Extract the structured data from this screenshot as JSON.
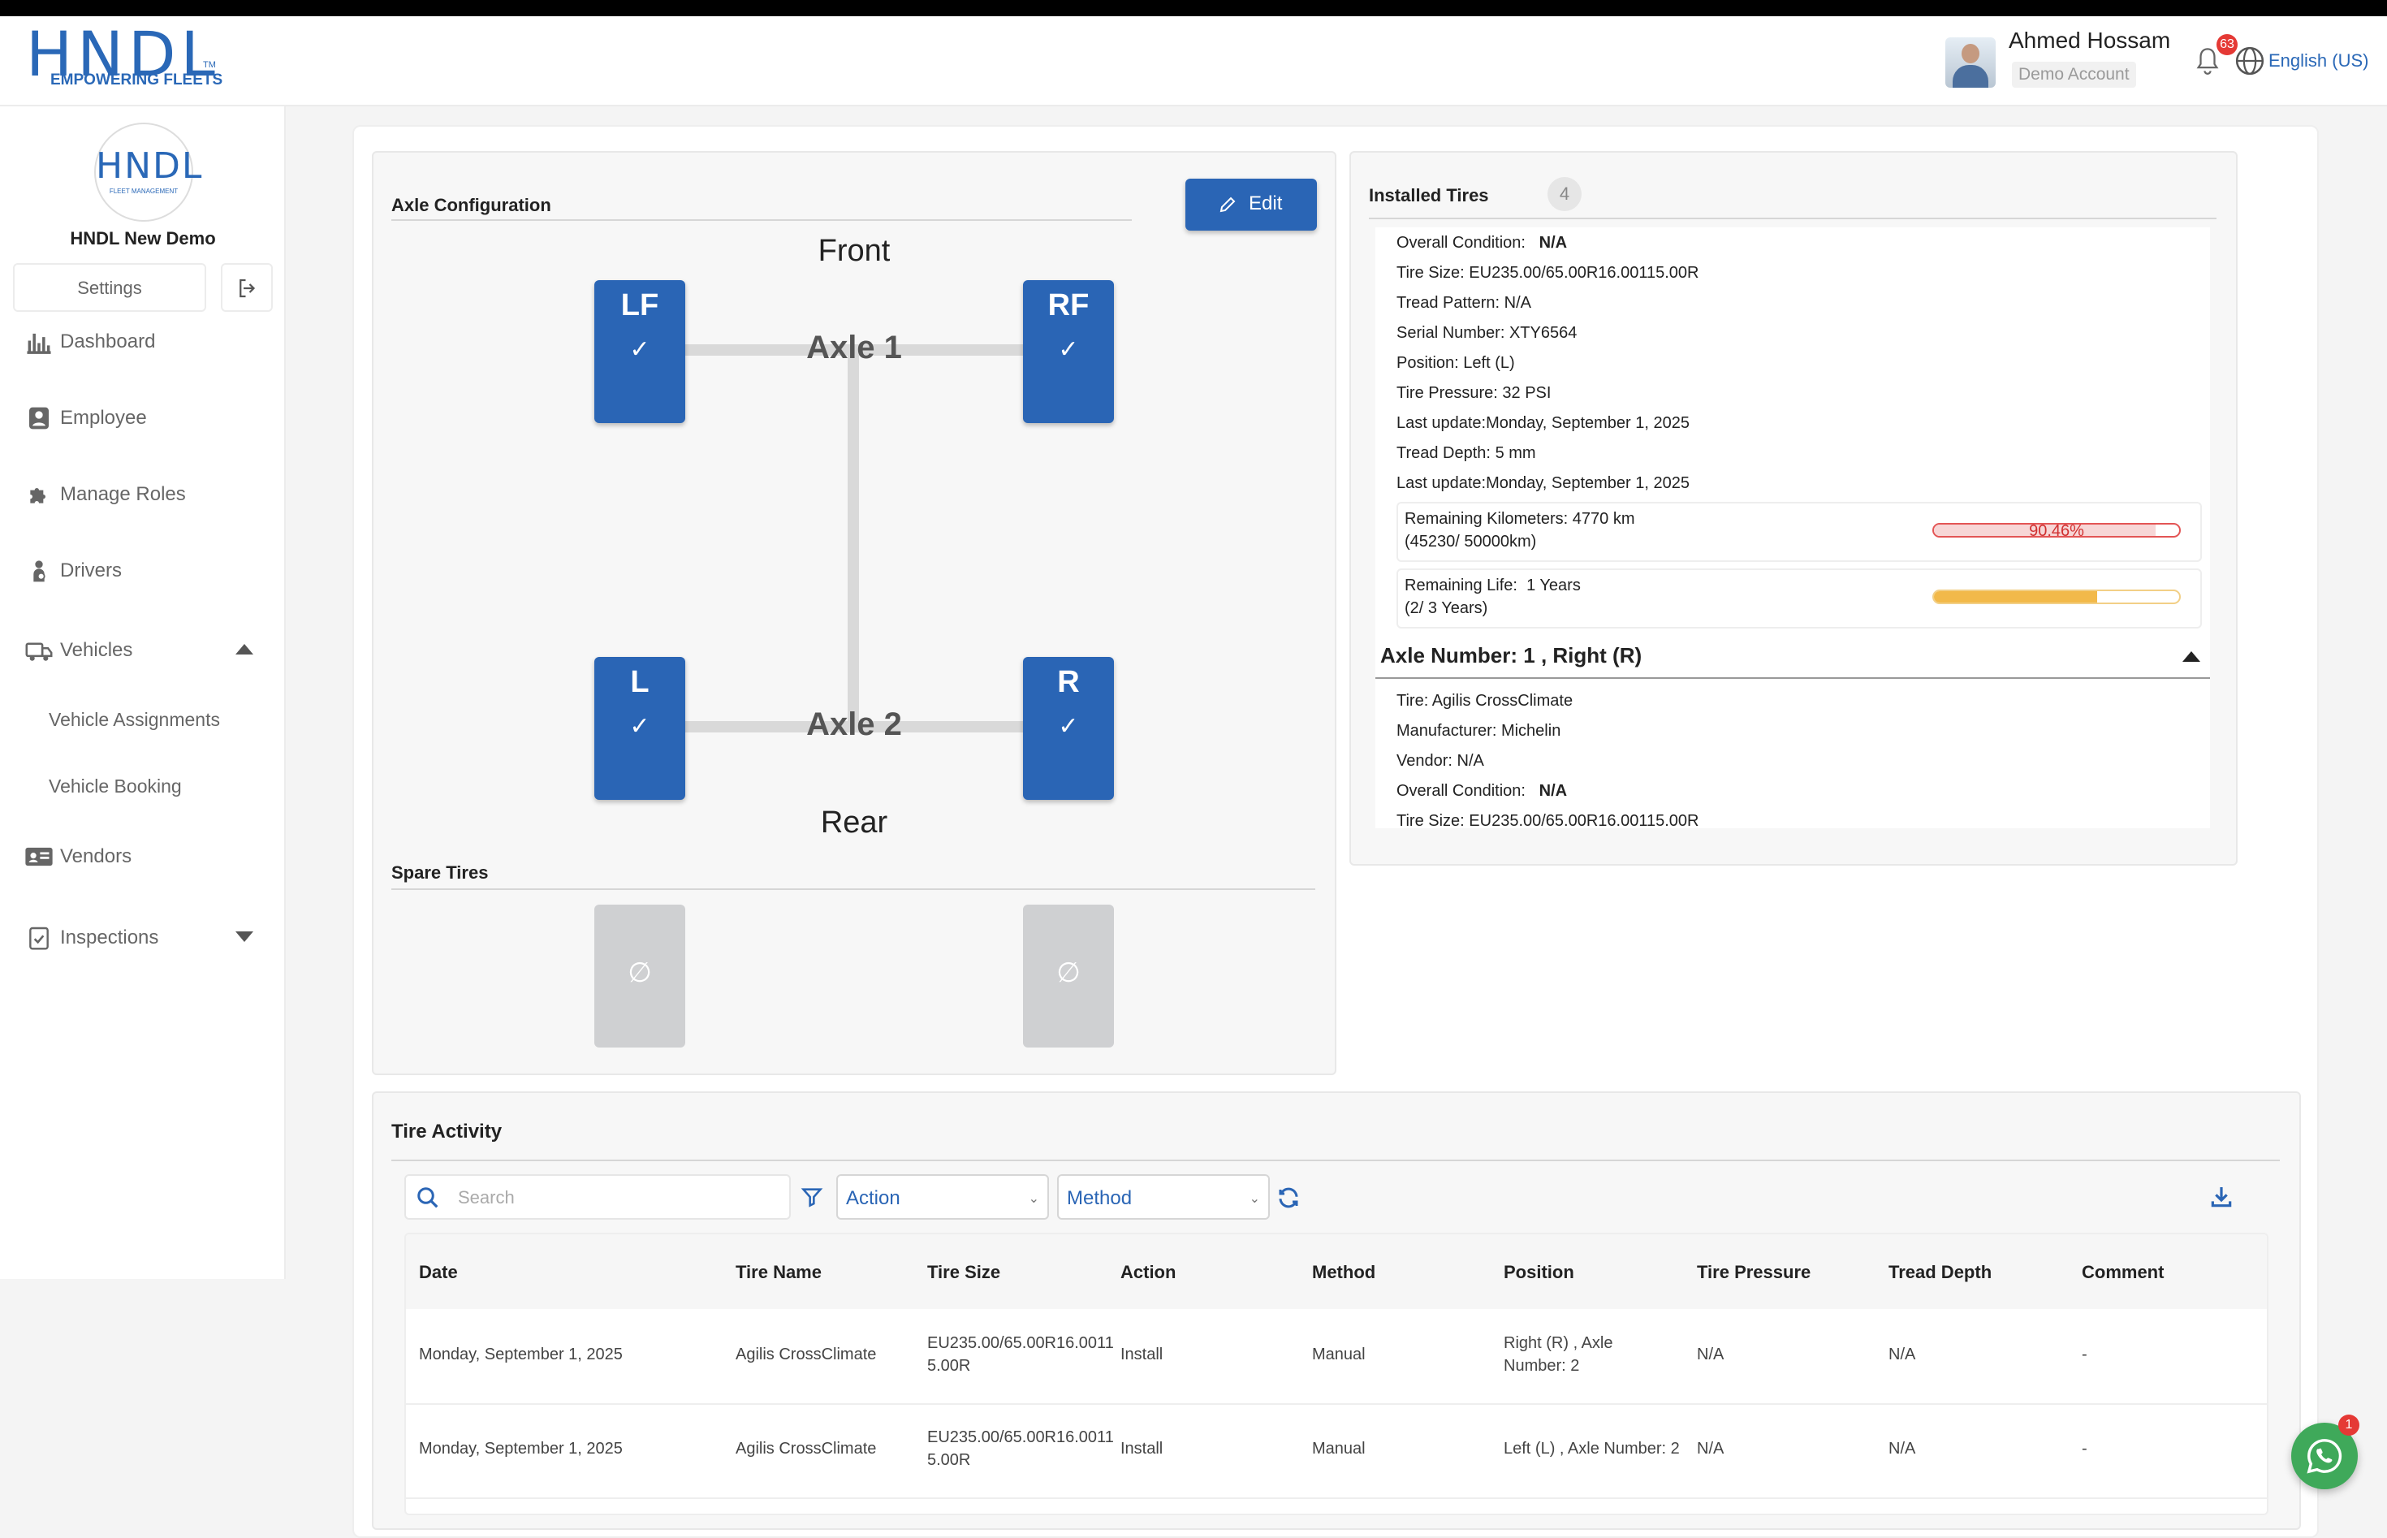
{
  "brand": {
    "name": "HNDL",
    "tagline": "EMPOWERING FLEETS",
    "tm": "TM"
  },
  "user": {
    "name": "Ahmed Hossam",
    "role": "Demo Account"
  },
  "notifications": {
    "count": "63"
  },
  "language": "English (US)",
  "org": {
    "logo_text": "HNDL",
    "logo_sub": "FLEET MANAGEMENT",
    "name": "HNDL New Demo"
  },
  "sidebar": {
    "settings_label": "Settings",
    "items": [
      {
        "label": "Dashboard",
        "icon": "chart-bar-icon"
      },
      {
        "label": "Employee",
        "icon": "person-badge-icon"
      },
      {
        "label": "Manage Roles",
        "icon": "puzzle-icon"
      },
      {
        "label": "Drivers",
        "icon": "driver-icon"
      },
      {
        "label": "Vehicles",
        "icon": "vehicle-icon",
        "expanded": true
      },
      {
        "label": "Vehicle Assignments"
      },
      {
        "label": "Vehicle Booking"
      },
      {
        "label": "Vendors",
        "icon": "id-card-icon"
      },
      {
        "label": "Inspections",
        "icon": "clipboard-check-icon",
        "expanded": false
      }
    ]
  },
  "axle_config": {
    "title": "Axle Configuration",
    "edit_label": "Edit",
    "front_label": "Front",
    "rear_label": "Rear",
    "axles": [
      {
        "name": "Axle 1",
        "left": "LF",
        "right": "RF"
      },
      {
        "name": "Axle 2",
        "left": "L",
        "right": "R"
      }
    ],
    "check": "✓",
    "spare_title": "Spare Tires",
    "spare_icon": "∅"
  },
  "installed": {
    "title": "Installed Tires",
    "count": "4",
    "lines": [
      {
        "label": "Overall Condition:",
        "value": "N/A",
        "bold_value": true
      },
      {
        "label": "Tire Size:",
        "value": "EU235.00/65.00R16.00115.00R"
      },
      {
        "label": "Tread Pattern:",
        "value": "N/A"
      },
      {
        "label": "Serial Number:",
        "value": "XTY6564"
      },
      {
        "label": "Position:",
        "value": "Left (L)"
      },
      {
        "label": "Tire Pressure:",
        "value": "32 PSI"
      },
      {
        "label": "Last update:",
        "value": "Monday, September 1, 2025"
      },
      {
        "label": "Tread Depth:",
        "value": "5 mm"
      },
      {
        "label": "Last update:",
        "value": "Monday, September 1, 2025"
      }
    ],
    "km": {
      "label": "Remaining Kilometers:",
      "value": "4770 km",
      "detail": "(45230/ 50000km)",
      "percent_text": "90.46%",
      "fraction": 0.9046,
      "color": "#e35555"
    },
    "life": {
      "label": "Remaining Life:",
      "value": "1 Years",
      "detail": "(2/ 3 Years)",
      "fraction": 0.6667,
      "color": "#f2b94a"
    },
    "axle2_title": "Axle Number: 1 , Right (R)",
    "axle2_lines": [
      {
        "label": "Tire:",
        "value": "Agilis CrossClimate"
      },
      {
        "label": "Manufacturer:",
        "value": "Michelin"
      },
      {
        "label": "Vendor:",
        "value": "N/A"
      },
      {
        "label": "Overall Condition:",
        "value": "N/A",
        "bold_value": true
      },
      {
        "label": "Tire Size:",
        "value": "EU235.00/65.00R16.00115.00R"
      }
    ]
  },
  "activity": {
    "title": "Tire Activity",
    "search_placeholder": "Search",
    "action_select": "Action",
    "method_select": "Method",
    "columns": [
      "Date",
      "Tire Name",
      "Tire Size",
      "Action",
      "Method",
      "Position",
      "Tire Pressure",
      "Tread Depth",
      "Comment"
    ],
    "rows": [
      {
        "date": "Monday, September 1, 2025",
        "tire": "Agilis CrossClimate",
        "size1": "EU235.00/65.00R16.0011",
        "size2": "5.00R",
        "action": "Install",
        "method": "Manual",
        "pos1": "Right (R) , Axle",
        "pos2": "Number: 2",
        "pressure": "N/A",
        "depth": "N/A",
        "comment": "-"
      },
      {
        "date": "Monday, September 1, 2025",
        "tire": "Agilis CrossClimate",
        "size1": "EU235.00/65.00R16.0011",
        "size2": "5.00R",
        "action": "Install",
        "method": "Manual",
        "pos1": "Left (L) , Axle Number: 2",
        "pos2": "",
        "pressure": "N/A",
        "depth": "N/A",
        "comment": "-"
      }
    ]
  },
  "chat": {
    "badge": "1"
  },
  "colors": {
    "primary": "#2a65b5",
    "accent_red": "#e53935",
    "whatsapp": "#3fa95a"
  }
}
